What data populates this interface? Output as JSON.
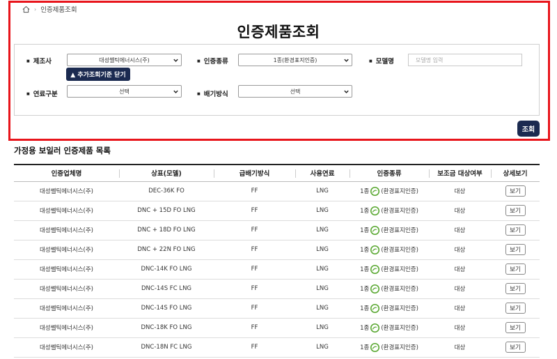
{
  "breadcrumb": {
    "current": "인증제품조회"
  },
  "page_title": "인증제품조회",
  "filters": {
    "manufacturer": {
      "label": "제조사",
      "value": "대성쎌틱에너시스(주)"
    },
    "cert_type": {
      "label": "인증종류",
      "value": "1종(환경표지인증)"
    },
    "model": {
      "label": "모델명",
      "placeholder": "모델명 입력"
    },
    "fuel": {
      "label": "연료구분",
      "value": "선택"
    },
    "exhaust": {
      "label": "배기방식",
      "value": "선택"
    },
    "toggle_label": "▲ 추가조회기준 닫기"
  },
  "search_label": "조회",
  "list_title": "가정용 보일러 인증제품 목록",
  "table": {
    "headers": [
      "인증업체명",
      "상표(모델)",
      "급배기방식",
      "사용연료",
      "인증종류",
      "보조금 대상여부",
      "상세보기"
    ],
    "rows": [
      {
        "company": "대성쎌틱에너시스(주)",
        "model": "DEC-36K FO",
        "exhaust": "FF",
        "fuel": "LNG",
        "cert_prefix": "1종",
        "cert_suffix": "(환경표지인증)",
        "subsidy": "대상",
        "view": "보기"
      },
      {
        "company": "대성쎌틱에너시스(주)",
        "model": "DNC + 15D FO LNG",
        "exhaust": "FF",
        "fuel": "LNG",
        "cert_prefix": "1종",
        "cert_suffix": "(환경표지인증)",
        "subsidy": "대상",
        "view": "보기"
      },
      {
        "company": "대성쎌틱에너시스(주)",
        "model": "DNC + 18D FO LNG",
        "exhaust": "FF",
        "fuel": "LNG",
        "cert_prefix": "1종",
        "cert_suffix": "(환경표지인증)",
        "subsidy": "대상",
        "view": "보기"
      },
      {
        "company": "대성쎌틱에너시스(주)",
        "model": "DNC + 22N FO LNG",
        "exhaust": "FF",
        "fuel": "LNG",
        "cert_prefix": "1종",
        "cert_suffix": "(환경표지인증)",
        "subsidy": "대상",
        "view": "보기"
      },
      {
        "company": "대성쎌틱에너시스(주)",
        "model": "DNC-14K FO LNG",
        "exhaust": "FF",
        "fuel": "LNG",
        "cert_prefix": "1종",
        "cert_suffix": "(환경표지인증)",
        "subsidy": "대상",
        "view": "보기"
      },
      {
        "company": "대성쎌틱에너시스(주)",
        "model": "DNC-14S FC LNG",
        "exhaust": "FF",
        "fuel": "LNG",
        "cert_prefix": "1종",
        "cert_suffix": "(환경표지인증)",
        "subsidy": "대상",
        "view": "보기"
      },
      {
        "company": "대성쎌틱에너시스(주)",
        "model": "DNC-14S FO LNG",
        "exhaust": "FF",
        "fuel": "LNG",
        "cert_prefix": "1종",
        "cert_suffix": "(환경표지인증)",
        "subsidy": "대상",
        "view": "보기"
      },
      {
        "company": "대성쎌틱에너시스(주)",
        "model": "DNC-18K FO LNG",
        "exhaust": "FF",
        "fuel": "LNG",
        "cert_prefix": "1종",
        "cert_suffix": "(환경표지인증)",
        "subsidy": "대상",
        "view": "보기"
      },
      {
        "company": "대성쎌틱에너시스(주)",
        "model": "DNC-18N FC LNG",
        "exhaust": "FF",
        "fuel": "LNG",
        "cert_prefix": "1종",
        "cert_suffix": "(환경표지인증)",
        "subsidy": "대상",
        "view": "보기"
      }
    ]
  },
  "colors": {
    "highlight": "#e8141b",
    "primary_button": "#1b2a50",
    "eco_mark": "#5aa832"
  },
  "icons": {
    "home": "home-icon",
    "dropdown": "chevron-down-icon",
    "eco_mark": "eco-label-icon"
  }
}
